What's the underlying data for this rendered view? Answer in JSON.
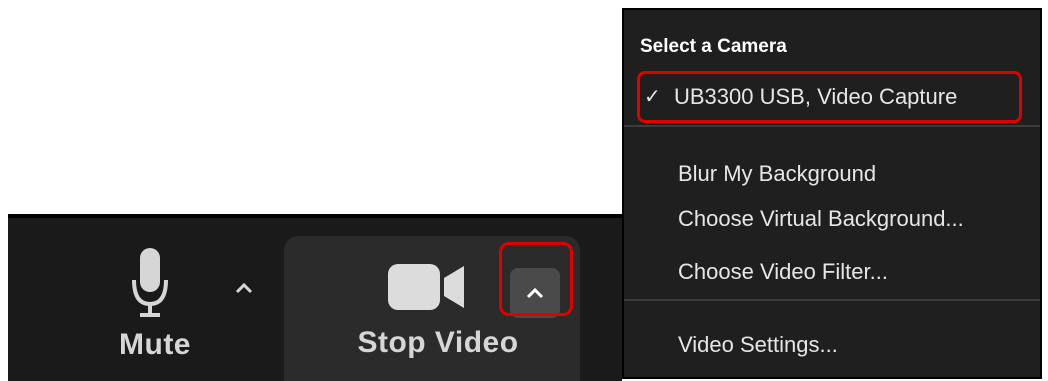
{
  "toolbar": {
    "mute": {
      "label": "Mute",
      "icon": "microphone-icon"
    },
    "video": {
      "label": "Stop Video",
      "icon": "video-camera-icon"
    },
    "caret_icon": "chevron-up-icon"
  },
  "camera_menu": {
    "header": "Select a Camera",
    "selected_camera": "UB3300 USB, Video Capture",
    "check_icon": "checkmark-icon",
    "items": [
      "Blur My Background",
      "Choose Virtual Background...",
      "Choose Video Filter..."
    ],
    "settings": "Video Settings..."
  },
  "colors": {
    "toolbar_bg": "#1a1a1a",
    "menu_bg": "#1f1f1f",
    "highlight": "#e00000",
    "text": "#e6e6e6"
  }
}
